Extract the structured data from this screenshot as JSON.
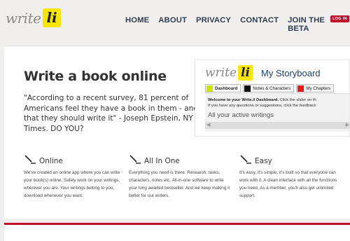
{
  "logo": {
    "word": "write",
    "badge": "li"
  },
  "nav": {
    "items": [
      {
        "label": "HOME"
      },
      {
        "label": "ABOUT"
      },
      {
        "label": "PRIVACY"
      },
      {
        "label": "CONTACT"
      },
      {
        "label": "JOIN THE BETA"
      }
    ],
    "login_label": "LOG IN"
  },
  "hero": {
    "headline": "Write a book online",
    "quote": "\"According to a recent survey, 81 percent of Americans feel they have a book in them - and that they should write it\" - Joseph Epstein, NY Times. DO YOU?"
  },
  "preview": {
    "logo_word": "write",
    "logo_badge": "li",
    "title": "My Storyboard",
    "tabs": [
      {
        "label": "Dashboard",
        "color": "#c8e600"
      },
      {
        "label": "Notes & Characters",
        "color": "#111111"
      },
      {
        "label": "My Chapters",
        "color": "#e21c1c"
      }
    ],
    "welcome_bold": "Welcome to your Write.li Dashboard.",
    "welcome_rest": " Click the slider on th",
    "welcome_line2": "If you have any questions or suggestions, click the feedback",
    "active_label": "All your active writings"
  },
  "features": [
    {
      "icon": "pen-icon",
      "title": "Online",
      "desc": "We've created an online app where you can write your book(s) online. Safely work on your writings, wherever you are. Your writings belong to you, download whenever you want."
    },
    {
      "icon": "pen-icon",
      "title": "All In One",
      "desc": "Everything you need is there. Research, tasks, characters, notes etc. All-in-one software to write your long awaited bestseller. And we keep making it better for our writers."
    },
    {
      "icon": "pen-icon",
      "title": "Easy",
      "desc": "It's easy, it's simple, it's built so that everyone can work with it. A clean interface with all the functions you need. As a member, you'll also get unlimited support."
    }
  ],
  "colors": {
    "accent_red": "#c0122a",
    "logo_yellow": "#f7e600",
    "nav_text": "#2e3e52",
    "title_blue": "#1e3f7c"
  }
}
